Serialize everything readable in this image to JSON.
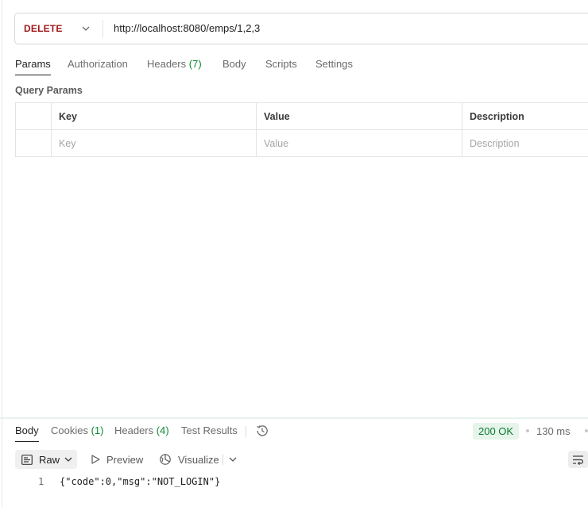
{
  "request": {
    "method": "DELETE",
    "url": "http://localhost:8080/emps/1,2,3"
  },
  "request_tabs": [
    {
      "label": "Params",
      "count": ""
    },
    {
      "label": "Authorization",
      "count": ""
    },
    {
      "label": "Headers",
      "count": "(7)"
    },
    {
      "label": "Body",
      "count": ""
    },
    {
      "label": "Scripts",
      "count": ""
    },
    {
      "label": "Settings",
      "count": ""
    }
  ],
  "query_params": {
    "title": "Query Params",
    "headers": {
      "key": "Key",
      "value": "Value",
      "description": "Description"
    },
    "placeholders": {
      "key": "Key",
      "value": "Value",
      "description": "Description"
    }
  },
  "response_tabs": [
    {
      "label": "Body",
      "count": ""
    },
    {
      "label": "Cookies",
      "count": "(1)"
    },
    {
      "label": "Headers",
      "count": "(4)"
    },
    {
      "label": "Test Results",
      "count": ""
    }
  ],
  "response_status": {
    "status": "200 OK",
    "time": "130 ms"
  },
  "response_toolbar": {
    "raw": "Raw",
    "preview": "Preview",
    "visualize": "Visualize"
  },
  "response_body": {
    "line_number": "1",
    "content": "{\"code\":0,\"msg\":\"NOT_LOGIN\"}"
  },
  "colors": {
    "method": "#a0191c",
    "status_bg": "#e6f4ea",
    "status_text": "#0b7a33",
    "count": "#0b8a33"
  }
}
